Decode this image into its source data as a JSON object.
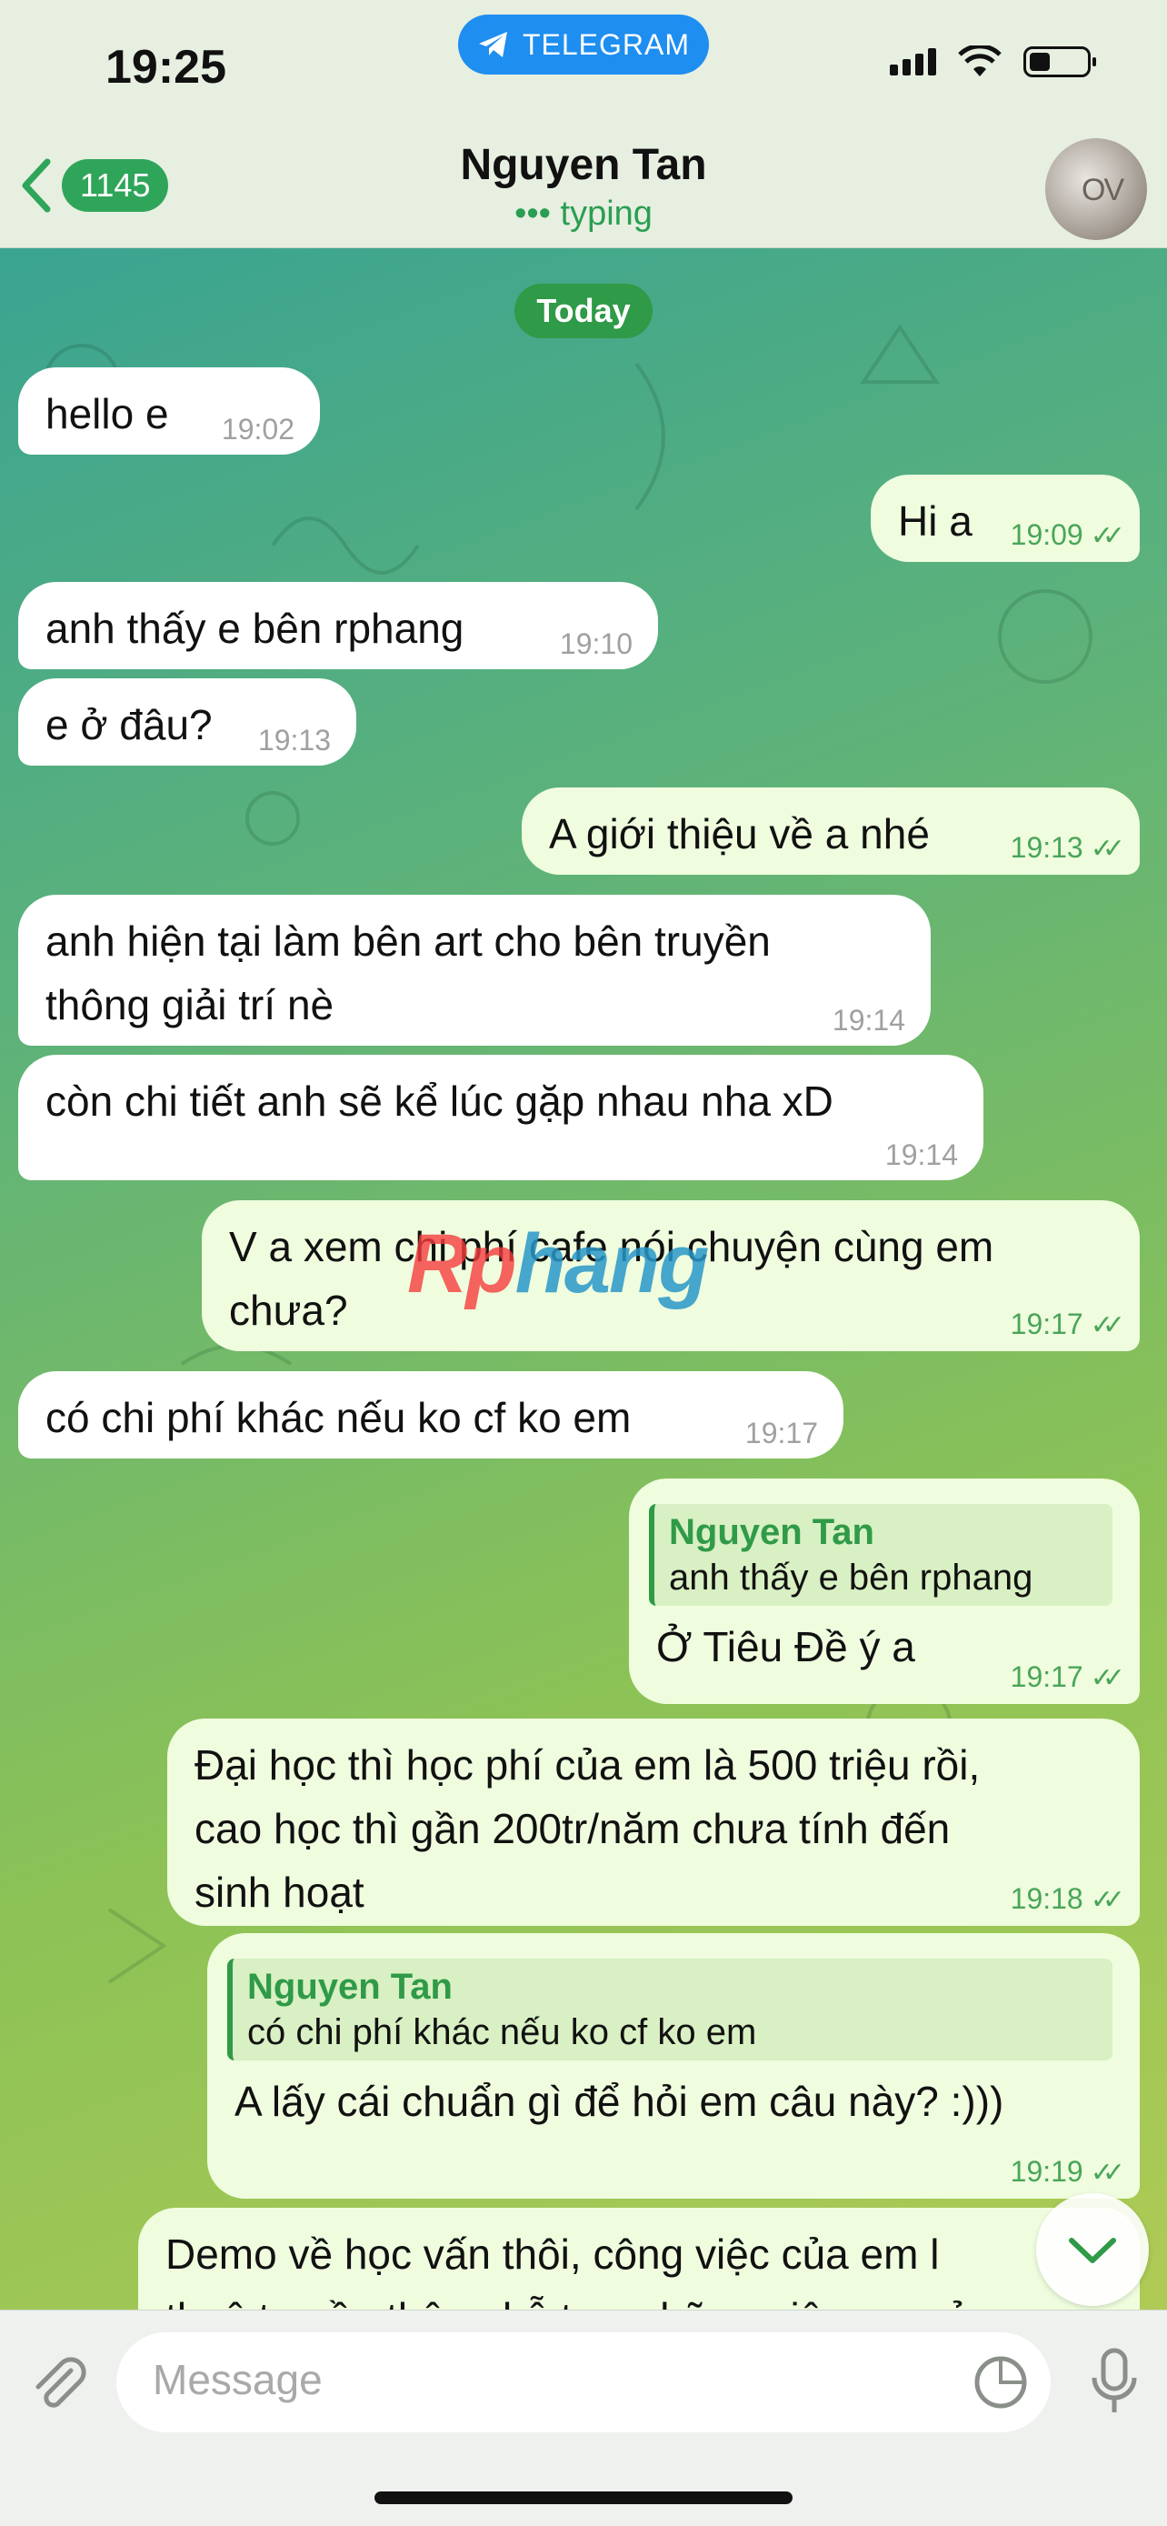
{
  "status_bar": {
    "time": "19:25",
    "app_badge": "TELEGRAM"
  },
  "header": {
    "back_count": "1145",
    "title": "Nguyen Tan",
    "subtitle": "••• typing",
    "avatar_text": "OV"
  },
  "date_label": "Today",
  "messages": [
    {
      "dir": "in",
      "lines": [
        "hello e"
      ],
      "time": "19:02"
    },
    {
      "dir": "out",
      "lines": [
        "Hi a"
      ],
      "time": "19:09"
    },
    {
      "dir": "in",
      "lines": [
        "anh thấy e bên rphang"
      ],
      "time": "19:10"
    },
    {
      "dir": "in",
      "lines": [
        "e ở đâu?"
      ],
      "time": "19:13"
    },
    {
      "dir": "out",
      "lines": [
        "A giới thiệu về a nhé"
      ],
      "time": "19:13"
    },
    {
      "dir": "in",
      "lines": [
        "anh hiện tại làm bên art cho bên truyền",
        "thông giải trí nè"
      ],
      "time": "19:14"
    },
    {
      "dir": "in",
      "lines": [
        "còn chi tiết anh sẽ kể lúc gặp nhau nha xD"
      ],
      "time": "19:14"
    },
    {
      "dir": "out",
      "lines": [
        "V a xem chi phí cafe nói chuyện cùng em",
        "chưa?"
      ],
      "time": "19:17"
    },
    {
      "dir": "in",
      "lines": [
        "có chi phí khác nếu ko cf ko em"
      ],
      "time": "19:17"
    },
    {
      "dir": "out",
      "reply_name": "Nguyen Tan",
      "reply_text": "anh thấy e bên rphang",
      "lines": [
        "Ở Tiêu Đề ý a"
      ],
      "time": "19:17"
    },
    {
      "dir": "out",
      "lines": [
        "Đại học thì học phí của em là 500 triệu rồi,",
        "cao học thì gần 200tr/năm chưa tính đến",
        "sinh hoạt"
      ],
      "time": "19:18"
    },
    {
      "dir": "out",
      "reply_name": "Nguyen Tan",
      "reply_text": "có chi phí khác nếu ko cf ko em",
      "lines": [
        "A lấy cái chuẩn gì để hỏi em câu này? :)))"
      ],
      "time": "19:19"
    },
    {
      "dir": "out",
      "lines": [
        "Demo về học vấn thôi, công việc của em l",
        "thuê truyền thông hỗ trợ, những việc em xử"
      ],
      "time": ""
    }
  ],
  "watermark": {
    "part1": "Rp",
    "part2": "hang"
  },
  "input": {
    "placeholder": "Message"
  },
  "colors": {
    "accent": "#2f9a47",
    "outgoing_bubble": "#effdde",
    "incoming_bubble": "#ffffff",
    "telegram_blue": "#1e8ef0"
  }
}
